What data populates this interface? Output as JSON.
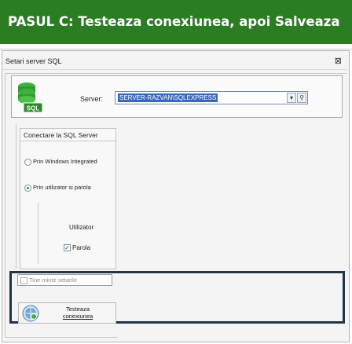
{
  "banner": {
    "text": "PASUL C: Testeaza conexiunea, apoi Salveaza"
  },
  "dialog": {
    "title": "Setari server SQL",
    "close_glyph": "⊠"
  },
  "server": {
    "label": "Server:",
    "value": "SERVER-RAZVAN\\SQLEXPRESS",
    "logo_icon": "sql-server-icon",
    "logo_text": "SQL"
  },
  "connection": {
    "title": "Conectare la SQL Server",
    "options": [
      {
        "label": "Prin Windows Integrated",
        "selected": false
      },
      {
        "label": "Prin utilizator si parola",
        "selected": true
      }
    ]
  },
  "credentials": {
    "user_label": "Utilizator",
    "password_checkbox": {
      "label": "Parola",
      "checked": true
    }
  },
  "remember": {
    "label": "Tine minte setarile",
    "enabled": false
  },
  "test_button": {
    "line1": "Testeaza",
    "line2": "conexiunea",
    "icon": "globe-connect-icon"
  },
  "colors": {
    "banner": "#2b7d22",
    "selection": "#3a68b9",
    "frame": "#203545"
  }
}
